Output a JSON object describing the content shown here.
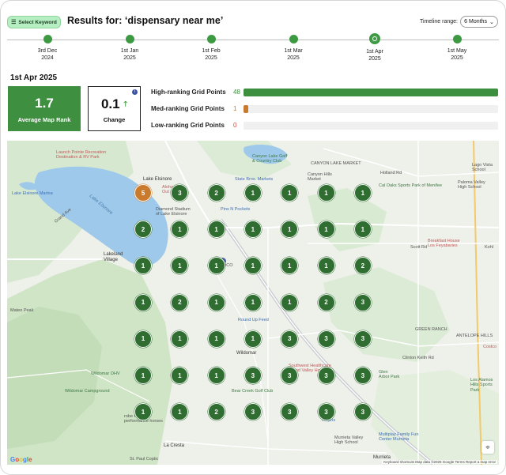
{
  "header": {
    "select_keyword_label": "Select Keyword",
    "results_title": "Results for: ‘dispensary near me’",
    "timeline_range_label": "Timeline range:",
    "timeline_range_value": "6 Months"
  },
  "timeline": [
    {
      "line1": "3rd Dec",
      "line2": "2024",
      "active": false
    },
    {
      "line1": "1st Jan",
      "line2": "2025",
      "active": false
    },
    {
      "line1": "1st Feb",
      "line2": "2025",
      "active": false
    },
    {
      "line1": "1st Mar",
      "line2": "2025",
      "active": false
    },
    {
      "line1": "1st Apr",
      "line2": "2025",
      "active": true
    },
    {
      "line1": "1st May",
      "line2": "2025",
      "active": false
    }
  ],
  "selected_date": "1st Apr 2025",
  "stats": {
    "average_rank": {
      "value": "1.7",
      "label": "Average Map Rank"
    },
    "change": {
      "value": "0.1",
      "label": "Change",
      "info": "i"
    }
  },
  "grid_points": [
    {
      "label": "High-ranking Grid Points",
      "count": 48,
      "fraction": 1.0,
      "color": "#3d8f40"
    },
    {
      "label": "Med-ranking Grid Points",
      "count": 1,
      "fraction": 0.02,
      "color": "#c97a2c"
    },
    {
      "label": "Low-ranking Grid Points",
      "count": 0,
      "fraction": 0,
      "color": "#d34b3b"
    }
  ],
  "map": {
    "grid": [
      [
        "5",
        "3",
        "2",
        "1",
        "1",
        "1",
        "1"
      ],
      [
        "2",
        "1",
        "1",
        "1",
        "1",
        "1",
        "1"
      ],
      [
        "1",
        "1",
        "1",
        "1",
        "1",
        "1",
        "2"
      ],
      [
        "1",
        "2",
        "1",
        "1",
        "1",
        "2",
        "3"
      ],
      [
        "1",
        "1",
        "1",
        "1",
        "3",
        "3",
        "3"
      ],
      [
        "1",
        "1",
        "1",
        "3",
        "3",
        "3",
        "3"
      ],
      [
        "1",
        "1",
        "2",
        "3",
        "3",
        "3",
        "3"
      ]
    ],
    "labels": {
      "launch_pointe": "Launch Pointe Recreation\nDestination & RV Park",
      "lake_elsinore_city": "Lake Elsinore",
      "lake_elsinore_lake": "Lake Elsinore",
      "lake_elsinore_marina": "Lake Elsinore Marina",
      "grand_ave": "Grand Ave",
      "lakeland_village": "Lakeland\nVillage",
      "mateo_peak": "Mateo Peak",
      "wildomar_ohv": "Wildomar OHV",
      "wildomar_campground": "Wildomar Campground",
      "robe_ranch": "robe Ranch\nperformance horses",
      "la_cresta": "La Cresta",
      "st_paul_coptic": "St. Paul Coptic",
      "canyon_lake_golf": "Canyon Lake Golf\n& Country Club",
      "canyon_lake_market": "CANYON LAKE MARKET",
      "canyon_hills": "Canyon Hills\nMarket",
      "state_bros": "State Bros. Markets",
      "aloha_j": "Aloha J's\nOut Bu",
      "diamond_stadium": "Diamond Stadium\nof Lake Elsinore",
      "pins_n_pockets": "Pins N Pockets",
      "goat_hill": "Goat Hill\nGolf Resort",
      "round_up_feed": "Round Up Feed",
      "wildomar": "Wildomar",
      "southwest_healthcare": "Southwest Healthcare\nInland Valley Hospital",
      "bear_creek_golf": "Bear Creek Golf Club",
      "ralphs": "Ralphs",
      "murrieta_valley_high": "Murrieta Valley\nHigh School",
      "murrieta": "Murrieta",
      "multiplay": "Multiplay Family Fun\nCenter Murrieta",
      "glen_arbor": "Glen\nArbor Park",
      "antelope_hills": "Los Alamos\nHills Sports\nPark",
      "green_ranch": "GREEN RANCH",
      "antelope_hills_road": "ANTELOPE HILLS",
      "breakfast_house": "Breakfast House\nLos Feyabaries",
      "cal_oaks": "Cal Oaks Sports Park of Menifee",
      "lago_vista": "Lago Vista\nSchool",
      "paloma_valley": "Paloma Valley\nHigh School",
      "holland_rd": "Holland Rd",
      "scott_rd": "Scott Rd",
      "clinton_keith_rd": "Clinton Keith Rd",
      "costco": "Costco",
      "kohl": "Kohl",
      "sedco": "SEDCO"
    },
    "footer": "Keyboard shortcuts   Map data ©2025 Google   Terms   Report a map error",
    "google": "Google"
  }
}
